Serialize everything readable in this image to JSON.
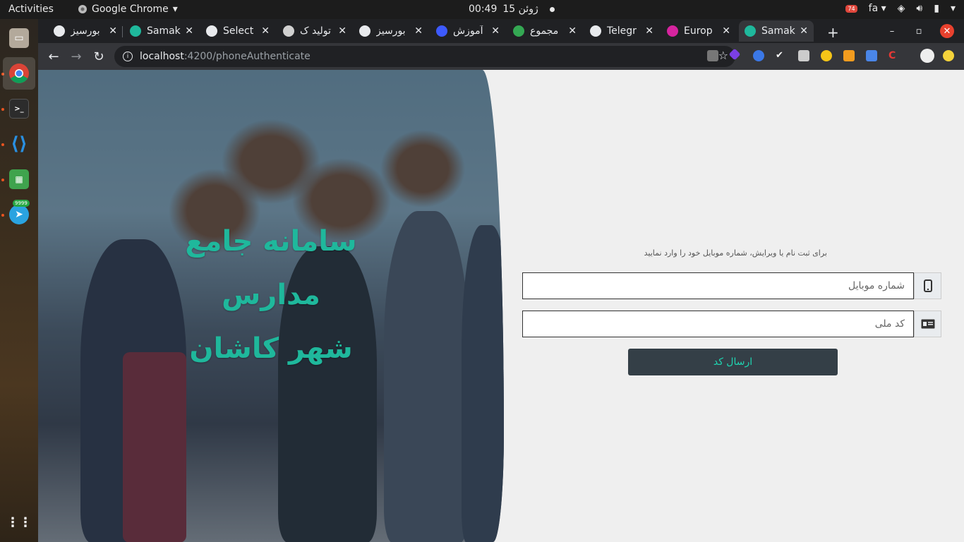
{
  "topbar": {
    "activities": "Activities",
    "app_menu": "Google Chrome",
    "time": "00:49",
    "date": "ژوئن 15",
    "indicator_badge": "74",
    "input_lang": "fa"
  },
  "dock": {
    "telegram_badge": "9999"
  },
  "tabs": [
    {
      "title": "بورسیز",
      "favicon": "globe-icon",
      "color": "#e8eaed"
    },
    {
      "title": "Samak",
      "favicon": "samak-icon",
      "color": "#1fb89c"
    },
    {
      "title": "Select",
      "favicon": "globe-icon",
      "color": "#e8eaed"
    },
    {
      "title": "تولید ک",
      "favicon": "document-icon",
      "color": "#d0d0d0"
    },
    {
      "title": "بورسیز",
      "favicon": "globe-icon",
      "color": "#e8eaed"
    },
    {
      "title": "آموزش",
      "favicon": "zz-icon",
      "color": "#3d5afe"
    },
    {
      "title": "مجموع",
      "favicon": "maps-pin-icon",
      "color": "#34a853"
    },
    {
      "title": "Telegr",
      "favicon": "globe-icon",
      "color": "#e8eaed"
    },
    {
      "title": "Europ",
      "favicon": "instagram-icon",
      "color": "#d6249f"
    },
    {
      "title": "Samak",
      "favicon": "samak-icon",
      "color": "#1fb89c"
    }
  ],
  "active_tab_index": 9,
  "address": {
    "host": "localhost",
    "path": ":4200/phoneAuthenticate"
  },
  "hero": {
    "line1": "سامانه جامع",
    "line2": "مدارس",
    "line3": "شهر کاشان"
  },
  "form": {
    "hint": "برای ثبت نام یا ویرایش، شماره موبایل خود را وارد نمایید",
    "phone_placeholder": "شماره موبایل",
    "phone_value": "",
    "national_id_placeholder": "کد ملی",
    "national_id_value": "",
    "submit_label": "ارسال کد"
  },
  "colors": {
    "accent": "#1fb89c",
    "button_bg": "#343f47"
  }
}
